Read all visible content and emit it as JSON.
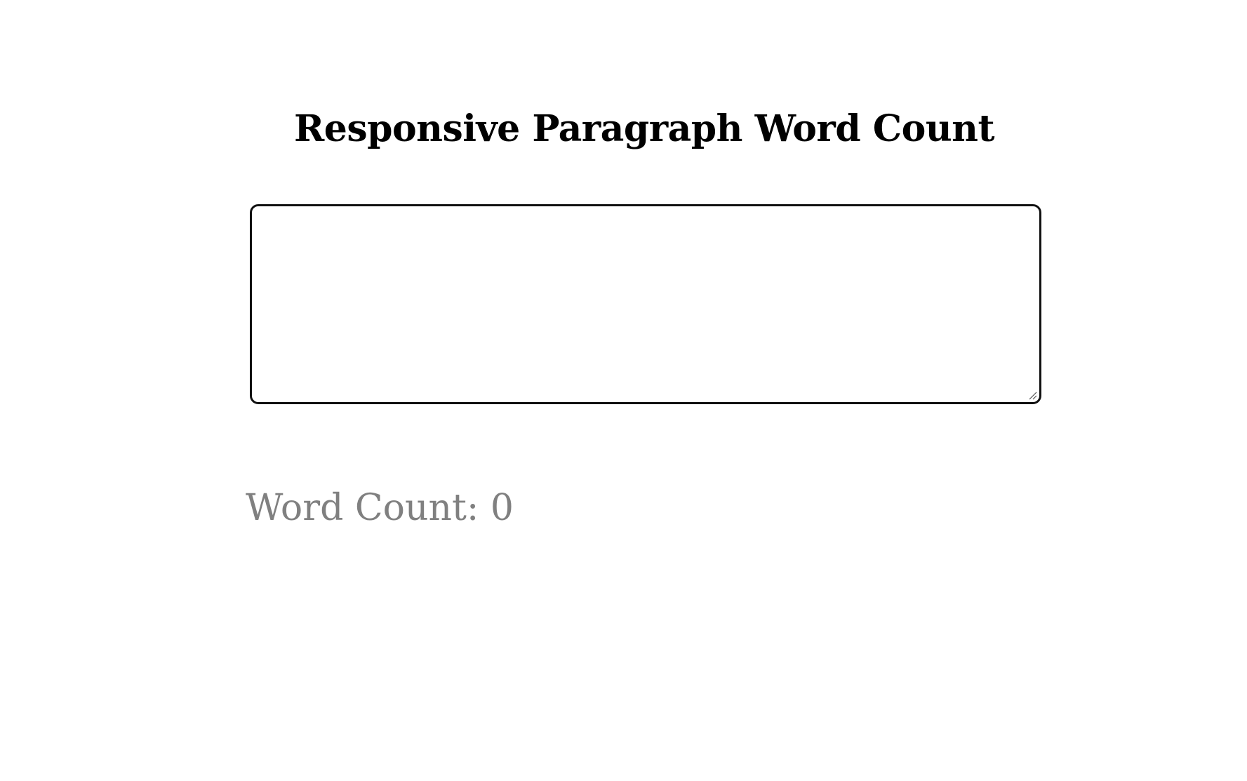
{
  "title": "Responsive Paragraph Word Count",
  "editor": {
    "value": "",
    "placeholder": ""
  },
  "word_count": {
    "label": "Word Count:",
    "value": "0"
  },
  "colors": {
    "title": "#000000",
    "textarea_border": "#111111",
    "count_text": "#808080",
    "background": "#ffffff"
  }
}
